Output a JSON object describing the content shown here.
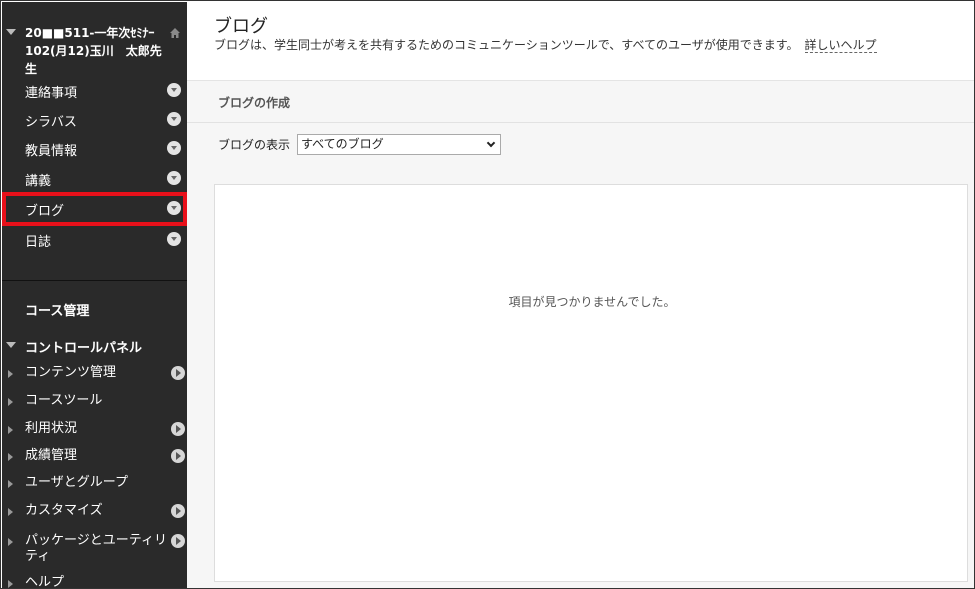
{
  "course": {
    "title": "20■■511-一年次ｾﾐﾅｰ102(月12)玉川　太郎先生"
  },
  "menu": {
    "items": [
      {
        "label": "連絡事項"
      },
      {
        "label": "シラバス"
      },
      {
        "label": "教員情報"
      },
      {
        "label": "講義"
      },
      {
        "label": "ブログ"
      },
      {
        "label": "日誌"
      }
    ]
  },
  "course_management": {
    "title": "コース管理",
    "control_panel": "コントロールパネル",
    "items": [
      {
        "label": "コンテンツ管理"
      },
      {
        "label": "コースツール"
      },
      {
        "label": "利用状況"
      },
      {
        "label": "成績管理"
      },
      {
        "label": "ユーザとグループ"
      },
      {
        "label": "カスタマイズ"
      },
      {
        "label": "パッケージとユーティリティ"
      },
      {
        "label": "ヘルプ"
      }
    ]
  },
  "page": {
    "title": "ブログ",
    "description": "ブログは、学生同士が考えを共有するためのコミュニケーションツールで、すべてのユーザが使用できます。",
    "help_link": "詳しいヘルプ"
  },
  "actions": {
    "create_blog": "ブログの作成"
  },
  "view": {
    "label": "ブログの表示",
    "selected": "すべてのブログ"
  },
  "empty": {
    "message": "項目が見つかりませんでした。"
  },
  "colors": {
    "sidebar_bg": "#2a2a2a",
    "highlight": "#e8101a"
  }
}
